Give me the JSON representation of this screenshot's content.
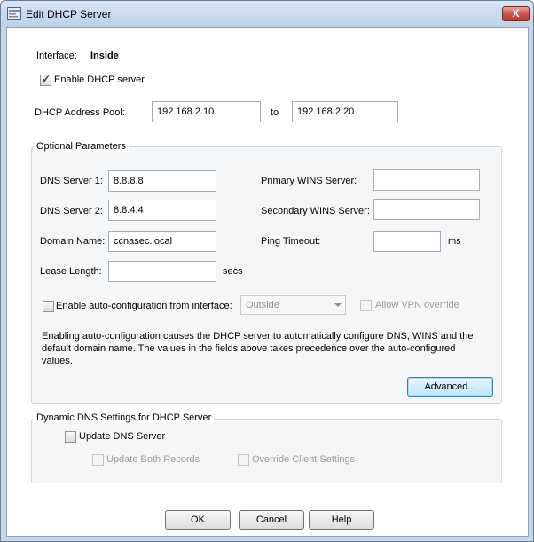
{
  "window": {
    "title": "Edit DHCP Server",
    "close_label": "X"
  },
  "interface": {
    "label": "Interface:",
    "value": "Inside"
  },
  "enable_dhcp": {
    "label": "Enable DHCP server",
    "checked": true
  },
  "address_pool": {
    "label": "DHCP Address Pool:",
    "start": "192.168.2.10",
    "to_label": "to",
    "end": "192.168.2.20"
  },
  "optional": {
    "title": "Optional Parameters",
    "dns1_label": "DNS Server 1:",
    "dns1_value": "8.8.8.8",
    "dns2_label": "DNS Server 2:",
    "dns2_value": "8.8.4.4",
    "domain_label": "Domain Name:",
    "domain_value": "ccnasec.local",
    "lease_label": "Lease Length:",
    "lease_value": "",
    "lease_unit": "secs",
    "wins1_label": "Primary WINS Server:",
    "wins1_value": "",
    "wins2_label": "Secondary WINS Server:",
    "wins2_value": "",
    "ping_label": "Ping Timeout:",
    "ping_value": "",
    "ping_unit": "ms",
    "auto_config_label": "Enable auto-configuration from interface:",
    "auto_config_interface": "Outside",
    "vpn_override_label": "Allow VPN override",
    "description_line1": "Enabling auto-configuration causes the DHCP server to automatically configure DNS, WINS and the",
    "description_line2": "default domain name. The values in the fields above takes precedence over the auto-configured",
    "description_line3": "values.",
    "advanced_label": "Advanced..."
  },
  "ddns": {
    "title": "Dynamic DNS Settings for DHCP Server",
    "update_dns_label": "Update DNS Server",
    "update_both_label": "Update Both Records",
    "override_client_label": "Override Client Settings"
  },
  "buttons": {
    "ok": "OK",
    "cancel": "Cancel",
    "help": "Help"
  }
}
